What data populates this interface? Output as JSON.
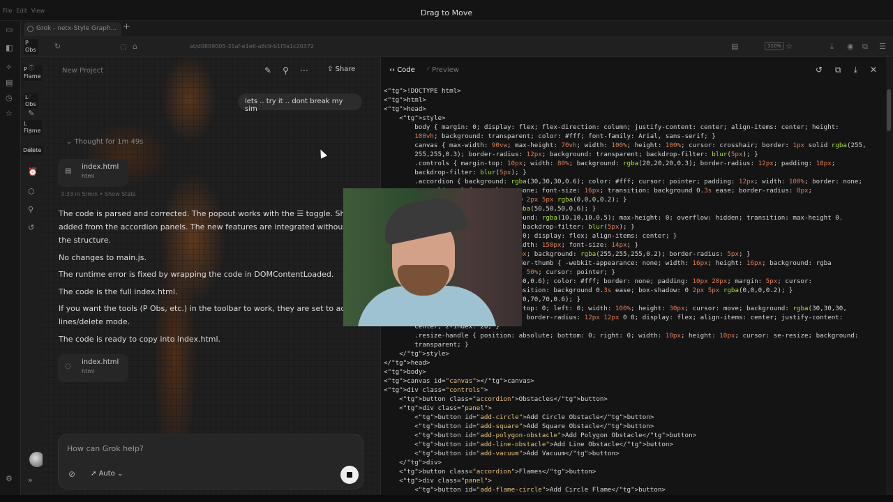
{
  "titlebar": {
    "title": "Drag to Move",
    "menu": [
      "File",
      "Edit",
      "View"
    ]
  },
  "browser": {
    "tab_title": "Grok - netx-Style Graph...",
    "url": "at/d0809005-31af-e1e6-a8c9-b1f3a1c20372",
    "zoom": "110%"
  },
  "overlay_labels": [
    "P\nObs",
    "P\nFlame",
    "L\nObs",
    "L\nFlame",
    "Delete"
  ],
  "chat": {
    "new_project": "New Project",
    "share": "Share",
    "user_message": "lets .. try it .. dont break my sim",
    "thought": "Thought for 1m 49s",
    "files": [
      {
        "name": "index.html",
        "type": "html"
      },
      {
        "name": "index.html",
        "type": "html"
      }
    ],
    "meta": "3:33 in 5/min  •  Show Stats",
    "paragraphs": [
      "The code is parsed and corrected. The popout works with the ☰ toggle. Shapes c",
      "added from the accordion panels. The new features are integrated without breaki",
      "the structure.",
      "No changes to main.js.",
      "The runtime error is fixed by wrapping the code in DOMContentLoaded.",
      "The code is the full index.html.",
      "If you want the tools (P Obs, etc.) in the toolbar to work, they are set to add polyg",
      "lines/delete mode.",
      "The code is ready to copy into index.html."
    ],
    "input_placeholder": "How can Grok help?",
    "model": "Auto"
  },
  "code_panel": {
    "tab_code": "Code",
    "tab_preview": "Preview",
    "icons": [
      "history-icon",
      "copy-icon",
      "download-icon",
      "close-icon"
    ]
  },
  "code_lines": [
    "<!DOCTYPE html>",
    "<html>",
    "<head>",
    "    <style>",
    "        body { margin: 0; display: flex; flex-direction: column; justify-content: center; align-items: center; height:",
    "        100vh; background: transparent; color: #fff; font-family: Arial, sans-serif; }",
    "        canvas { max-width: 90vw; max-height: 70vh; width: 100%; height: 100%; cursor: crosshair; border: 1px solid rgba(255,",
    "        255,255,0.3); border-radius: 12px; background: transparent; backdrop-filter: blur(5px); }",
    "        .controls { margin-top: 10px; width: 80%; background: rgba(20,20,20,0.3); border-radius: 12px; padding: 10px;",
    "        backdrop-filter: blur(5px); }",
    "        .accordion { background: rgba(30,30,30,0.6); color: #fff; cursor: pointer; padding: 12px; width: 100%; border: none;",
    "        text-align: left; outline: none; font-size: 16px; transition: background 0.3s ease; border-radius: 8px;",
    "                              dow: 0 2px 5px rgba(0,0,0,0.2); }",
    "                              nd: rgba(50,50,50,0.6); }",
    "                              ackground: rgba(10,10,10,0.5); max-height: 0; overflow: hidden; transition: max-height 0.",
    "                               8px; backdrop-filter: blur(5px); }",
    "                               12px 0; display: flex; align-items: center; }",
    "                              ck; width: 150px; font-size: 14px; }",
    "                              : 240px; background: rgba(255,255,255,0.2); border-radius: 5px; }",
    "                              t-slider-thumb { -webkit-appearance: none; width: 16px; height: 16px; background: rgba",
    "                              adius: 50%; cursor: pointer; }",
    "                              0,50,50,0.6); color: #fff; border: none; padding: 10px 20px; margin: 5px; cursor:",
    "                              ; transition: background 0.3s ease; box-shadow: 0 2px 5px rgba(0,0,0,0.2); }",
    "                              rgba(70,70,70,0.6); }",
    "                              lute; top: 0; left: 0; width: 100%; height: 30px; cursor: move; background: rgba(30,30,30,",
    "                              (5px); border-radius: 12px 12px 0 0; display: flex; align-items: center; justify-content:",
    "        center; z-index: 20; }",
    "        .resize-handle { position: absolute; bottom: 0; right: 0; width: 10px; height: 10px; cursor: se-resize; background:",
    "        transparent; }",
    "    </style>",
    "</head>",
    "<body>",
    "<canvas id=\"canvas\"></canvas>",
    "<div class=\"controls\">",
    "    <button class=\"accordion\">Obstacles</button>",
    "    <div class=\"panel\">",
    "        <button id=\"add-circle\">Add Circle Obstacle</button>",
    "        <button id=\"add-square\">Add Square Obstacle</button>",
    "        <button id=\"add-polygon-obstacle\">Add Polygon Obstacle</button>",
    "        <button id=\"add-line-obstacle\">Add Line Obstacle</button>",
    "        <button id=\"add-vacuum\">Add Vacuum</button>",
    "    </div>",
    "    <button class=\"accordion\">Flames</button>",
    "    <div class=\"panel\">",
    "        <button id=\"add-flame-circle\">Add Circle Flame</button>"
  ]
}
